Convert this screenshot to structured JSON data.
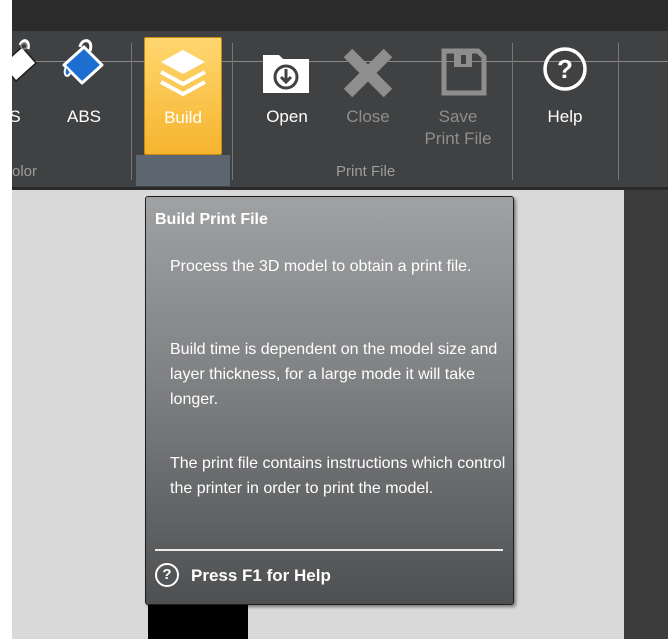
{
  "ribbon": {
    "buttons": {
      "partial_label": "S",
      "abs_label": "ABS",
      "build_label": "Build",
      "open_label": "Open",
      "close_label": "Close",
      "save_label_line1": "Save",
      "save_label_line2": "Print File",
      "help_label": "Help"
    },
    "groups": {
      "color_partial": "olor",
      "print_file": "Print File"
    },
    "icons": {
      "color_icons": [
        "paint-bucket-icon",
        "paint-bucket-icon"
      ],
      "build": "layers-icon",
      "open": "folder-icon",
      "close": "close-x-icon",
      "save": "floppy-disk-icon",
      "help": "help-circle-icon"
    },
    "colors": {
      "paint_blue": "#1c6fd1",
      "build_gold": "#f5b42e"
    }
  },
  "tooltip": {
    "title": "Build Print File",
    "paragraph1": "Process the 3D model to obtain a print file.",
    "paragraph2": "Build time is dependent on the model size and layer thickness, for a large mode it will take longer.",
    "paragraph3": "The print file contains instructions which control the printer in order to print the model.",
    "help_icon_glyph": "?",
    "help_text": "Press F1 for Help"
  }
}
